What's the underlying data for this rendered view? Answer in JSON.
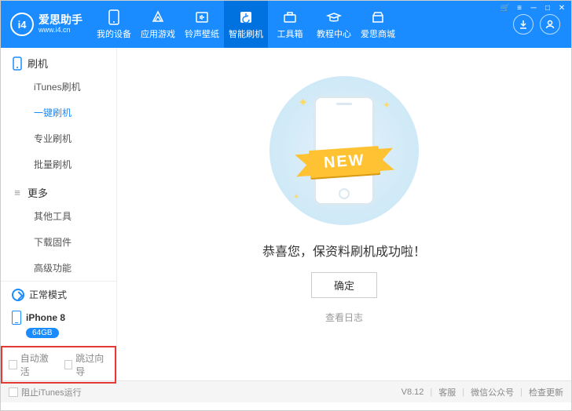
{
  "logo": {
    "badge": "i4",
    "title": "爱思助手",
    "sub": "www.i4.cn"
  },
  "nav": [
    {
      "label": "我的设备",
      "icon": "device"
    },
    {
      "label": "应用游戏",
      "icon": "apps"
    },
    {
      "label": "铃声壁纸",
      "icon": "ringtone"
    },
    {
      "label": "智能刷机",
      "icon": "flash"
    },
    {
      "label": "工具箱",
      "icon": "toolbox"
    },
    {
      "label": "教程中心",
      "icon": "tutorial"
    },
    {
      "label": "爱思商城",
      "icon": "store"
    }
  ],
  "sidebar": {
    "section1": "刷机",
    "items1": [
      "iTunes刷机",
      "一键刷机",
      "专业刷机",
      "批量刷机"
    ],
    "section2": "更多",
    "items2": [
      "其他工具",
      "下载固件",
      "高级功能"
    ],
    "status": "正常模式",
    "device": "iPhone 8",
    "storage": "64GB",
    "auto_activate": "自动激活",
    "skip_wizard": "跳过向导"
  },
  "main": {
    "ribbon": "NEW",
    "message": "恭喜您，保资料刷机成功啦！",
    "ok": "确定",
    "view_log": "查看日志"
  },
  "footer": {
    "block_itunes": "阻止iTunes运行",
    "version": "V8.12",
    "support": "客服",
    "wechat": "微信公众号",
    "update": "检查更新"
  }
}
